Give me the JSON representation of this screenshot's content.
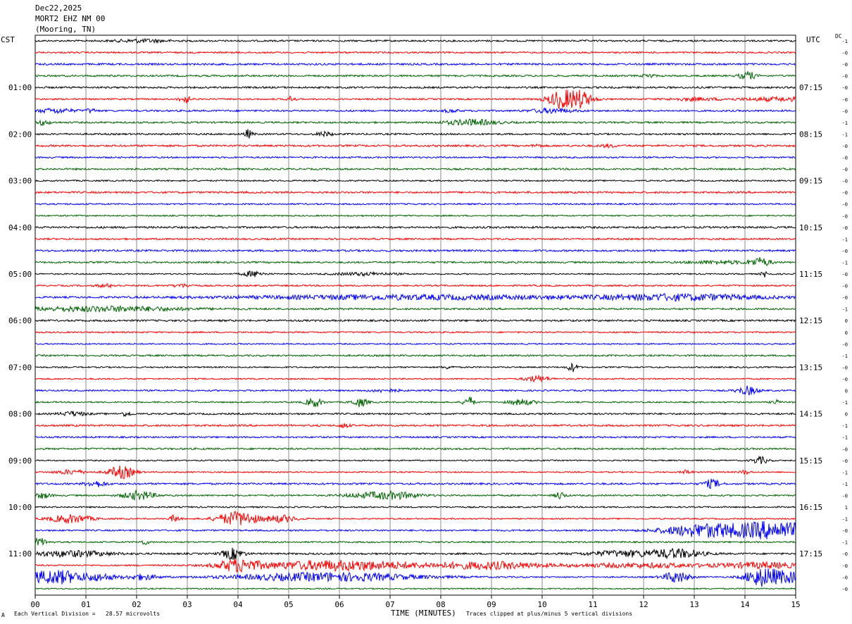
{
  "header": {
    "date": "Dec22,2025",
    "station": "MORT2 EHZ NM 00",
    "location": "(Mooring, TN)"
  },
  "left_tz": "CST",
  "right_tz": "UTC",
  "dc_label": "DC",
  "footer": {
    "left_mark": "A",
    "scale_note": "Each Vertical Division =   28.57 microvolts",
    "xlabel": "TIME (MINUTES)",
    "clip_note": "Traces clipped at plus/minus 5 vertical divisions"
  },
  "chart_data": {
    "type": "line",
    "subtype": "helicorder",
    "xlabel": "TIME (MINUTES)",
    "xlim": [
      0,
      15
    ],
    "x_ticks": [
      "00",
      "01",
      "02",
      "03",
      "04",
      "05",
      "06",
      "07",
      "08",
      "09",
      "10",
      "11",
      "12",
      "13",
      "14",
      "15"
    ],
    "grid": "vertical lines at each minute",
    "trace_colors": [
      "#000000",
      "#ff0000",
      "#0000ff",
      "#006400"
    ],
    "left_time_labels": [
      {
        "row": 4,
        "label": "01:00"
      },
      {
        "row": 8,
        "label": "02:00"
      },
      {
        "row": 12,
        "label": "03:00"
      },
      {
        "row": 16,
        "label": "04:00"
      },
      {
        "row": 20,
        "label": "05:00"
      },
      {
        "row": 24,
        "label": "06:00"
      },
      {
        "row": 28,
        "label": "07:00"
      },
      {
        "row": 32,
        "label": "08:00"
      },
      {
        "row": 36,
        "label": "09:00"
      },
      {
        "row": 40,
        "label": "10:00"
      },
      {
        "row": 44,
        "label": "11:00"
      }
    ],
    "right_time_labels": [
      {
        "row": 4,
        "label": "07:15"
      },
      {
        "row": 8,
        "label": "08:15"
      },
      {
        "row": 12,
        "label": "09:15"
      },
      {
        "row": 16,
        "label": "10:15"
      },
      {
        "row": 20,
        "label": "11:15"
      },
      {
        "row": 24,
        "label": "12:15"
      },
      {
        "row": 28,
        "label": "13:15"
      },
      {
        "row": 32,
        "label": "14:15"
      },
      {
        "row": 36,
        "label": "15:15"
      },
      {
        "row": 40,
        "label": "16:15"
      },
      {
        "row": 44,
        "label": "17:15"
      }
    ],
    "dc_offsets": [
      "-1",
      "-0",
      "-0",
      "-0",
      "-0",
      "-0",
      "-0",
      "-1",
      "-1",
      "-0",
      "-0",
      "-0",
      "-0",
      "-0",
      "-0",
      "-0",
      "-0",
      "-1",
      "-0",
      "-1",
      "-0",
      "-0",
      "-0",
      "-1",
      "0",
      "0",
      "-0",
      "-1",
      "-0",
      "-0",
      "0",
      "-1",
      "0",
      "-1",
      "-1",
      "-0",
      "-0",
      "-1",
      "-1",
      "-0",
      "1",
      "-1",
      "-0",
      "-1",
      "-0",
      "-0",
      "-0",
      "-0"
    ],
    "rows": 48,
    "events": [
      {
        "row": 0,
        "t": 2.1,
        "amp": 2,
        "w": 0.5
      },
      {
        "row": 3,
        "t": 12.1,
        "amp": 3,
        "w": 0.1
      },
      {
        "row": 3,
        "t": 14.05,
        "amp": 6,
        "w": 0.15
      },
      {
        "row": 5,
        "t": 2.95,
        "amp": 6,
        "w": 0.1
      },
      {
        "row": 5,
        "t": 5.05,
        "amp": 4,
        "w": 0.08
      },
      {
        "row": 5,
        "t": 10.55,
        "amp": 20,
        "w": 0.35
      },
      {
        "row": 5,
        "t": 13.0,
        "amp": 2,
        "w": 0.5
      },
      {
        "row": 5,
        "t": 14.7,
        "amp": 2.5,
        "w": 0.8
      },
      {
        "row": 6,
        "t": 0.4,
        "amp": 3,
        "w": 0.35
      },
      {
        "row": 6,
        "t": 1.1,
        "amp": 3,
        "w": 0.1
      },
      {
        "row": 6,
        "t": 8.2,
        "amp": 2,
        "w": 0.15
      },
      {
        "row": 6,
        "t": 10.2,
        "amp": 3,
        "w": 0.4
      },
      {
        "row": 7,
        "t": 0.15,
        "amp": 3,
        "w": 0.15
      },
      {
        "row": 7,
        "t": 8.6,
        "amp": 4,
        "w": 0.5
      },
      {
        "row": 8,
        "t": 4.2,
        "amp": 6,
        "w": 0.08
      },
      {
        "row": 8,
        "t": 5.7,
        "amp": 3,
        "w": 0.15
      },
      {
        "row": 9,
        "t": 9.9,
        "amp": 2,
        "w": 0.08
      },
      {
        "row": 9,
        "t": 11.3,
        "amp": 2,
        "w": 0.15
      },
      {
        "row": 19,
        "t": 14.3,
        "amp": 6,
        "w": 0.2
      },
      {
        "row": 19,
        "t": 13.5,
        "amp": 2,
        "w": 0.6
      },
      {
        "row": 20,
        "t": 4.3,
        "amp": 4,
        "w": 0.2
      },
      {
        "row": 20,
        "t": 6.5,
        "amp": 2,
        "w": 0.6
      },
      {
        "row": 20,
        "t": 14.4,
        "amp": 4,
        "w": 0.08
      },
      {
        "row": 21,
        "t": 1.4,
        "amp": 2,
        "w": 0.2
      },
      {
        "row": 21,
        "t": 2.9,
        "amp": 2,
        "w": 0.2
      },
      {
        "row": 22,
        "t": 7.5,
        "amp": 3,
        "w": 3.5
      },
      {
        "row": 22,
        "t": 12.8,
        "amp": 4,
        "w": 1.6
      },
      {
        "row": 23,
        "t": 1.4,
        "amp": 3.5,
        "w": 1.5
      },
      {
        "row": 28,
        "t": 10.6,
        "amp": 6,
        "w": 0.1
      },
      {
        "row": 28,
        "t": 8.15,
        "amp": 2,
        "w": 0.1
      },
      {
        "row": 29,
        "t": 9.9,
        "amp": 4,
        "w": 0.25
      },
      {
        "row": 30,
        "t": 14.05,
        "amp": 6,
        "w": 0.2
      },
      {
        "row": 30,
        "t": 6.9,
        "amp": 2,
        "w": 0.3
      },
      {
        "row": 31,
        "t": 5.5,
        "amp": 7,
        "w": 0.15
      },
      {
        "row": 31,
        "t": 6.4,
        "amp": 6,
        "w": 0.15
      },
      {
        "row": 31,
        "t": 8.55,
        "amp": 8,
        "w": 0.1
      },
      {
        "row": 31,
        "t": 9.6,
        "amp": 4,
        "w": 0.25
      },
      {
        "row": 31,
        "t": 14.6,
        "amp": 3,
        "w": 0.08
      },
      {
        "row": 32,
        "t": 0.75,
        "amp": 3,
        "w": 0.25
      },
      {
        "row": 32,
        "t": 1.8,
        "amp": 3,
        "w": 0.1
      },
      {
        "row": 33,
        "t": 6.1,
        "amp": 3,
        "w": 0.1
      },
      {
        "row": 36,
        "t": 14.3,
        "amp": 5,
        "w": 0.15
      },
      {
        "row": 37,
        "t": 1.7,
        "amp": 9,
        "w": 0.25
      },
      {
        "row": 37,
        "t": 0.7,
        "amp": 3,
        "w": 0.3
      },
      {
        "row": 37,
        "t": 12.85,
        "amp": 3,
        "w": 0.1
      },
      {
        "row": 37,
        "t": 14.0,
        "amp": 3,
        "w": 0.1
      },
      {
        "row": 38,
        "t": 1.2,
        "amp": 4,
        "w": 0.2
      },
      {
        "row": 38,
        "t": 13.35,
        "amp": 6,
        "w": 0.15
      },
      {
        "row": 39,
        "t": 0.15,
        "amp": 4,
        "w": 0.15
      },
      {
        "row": 39,
        "t": 2.05,
        "amp": 6,
        "w": 0.3
      },
      {
        "row": 39,
        "t": 7.05,
        "amp": 5,
        "w": 0.5
      },
      {
        "row": 39,
        "t": 10.35,
        "amp": 5,
        "w": 0.1
      },
      {
        "row": 39,
        "t": 6.4,
        "amp": 2,
        "w": 0.4
      },
      {
        "row": 41,
        "t": 0.7,
        "amp": 6,
        "w": 0.4
      },
      {
        "row": 41,
        "t": 2.75,
        "amp": 5,
        "w": 0.1
      },
      {
        "row": 41,
        "t": 4.0,
        "amp": 10,
        "w": 0.4
      },
      {
        "row": 41,
        "t": 4.85,
        "amp": 5,
        "w": 0.3
      },
      {
        "row": 42,
        "t": 13.2,
        "amp": 9,
        "w": 0.8
      },
      {
        "row": 42,
        "t": 14.6,
        "amp": 12,
        "w": 0.8
      },
      {
        "row": 43,
        "t": 0.1,
        "amp": 5,
        "w": 0.15
      },
      {
        "row": 43,
        "t": 2.15,
        "amp": 3,
        "w": 0.1
      },
      {
        "row": 44,
        "t": 0.7,
        "amp": 4,
        "w": 0.8
      },
      {
        "row": 44,
        "t": 3.9,
        "amp": 8,
        "w": 0.2
      },
      {
        "row": 44,
        "t": 11.6,
        "amp": 4,
        "w": 0.7
      },
      {
        "row": 44,
        "t": 12.65,
        "amp": 6,
        "w": 0.5
      },
      {
        "row": 45,
        "t": 4.0,
        "amp": 8,
        "w": 0.4
      },
      {
        "row": 45,
        "t": 6.0,
        "amp": 7,
        "w": 1.6
      },
      {
        "row": 45,
        "t": 9.0,
        "amp": 5,
        "w": 1.0
      },
      {
        "row": 45,
        "t": 12.0,
        "amp": 3,
        "w": 1.4
      },
      {
        "row": 45,
        "t": 14.4,
        "amp": 4,
        "w": 0.8
      },
      {
        "row": 46,
        "t": 0.4,
        "amp": 10,
        "w": 0.6
      },
      {
        "row": 46,
        "t": 1.3,
        "amp": 4,
        "w": 0.3
      },
      {
        "row": 46,
        "t": 2.1,
        "amp": 4,
        "w": 0.3
      },
      {
        "row": 46,
        "t": 5.8,
        "amp": 6,
        "w": 1.8
      },
      {
        "row": 46,
        "t": 12.65,
        "amp": 8,
        "w": 0.25
      },
      {
        "row": 46,
        "t": 14.3,
        "amp": 12,
        "w": 0.3
      },
      {
        "row": 46,
        "t": 14.8,
        "amp": 8,
        "w": 0.4
      }
    ]
  }
}
